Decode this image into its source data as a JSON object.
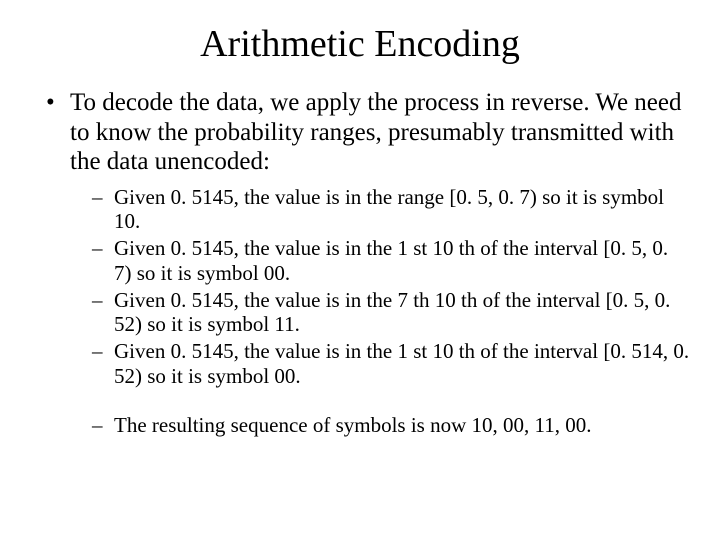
{
  "title": "Arithmetic Encoding",
  "main_bullet": "To decode the data, we apply the process in reverse.  We need to know the probability ranges, presumably transmitted with the data unencoded:",
  "sub": {
    "a": "Given 0. 5145, the value is in the range [0. 5, 0. 7) so it is symbol 10.",
    "b": "Given 0. 5145, the value is in the 1 st 10 th of the interval [0. 5, 0. 7) so it is symbol 00.",
    "c": "Given 0. 5145, the value is in the 7 th 10 th of the interval [0. 5, 0. 52) so it is symbol 11.",
    "d": "Given 0. 5145, the value is in the 1 st 10 th of the interval [0. 514, 0. 52) so it is symbol 00.",
    "e": "The resulting sequence of symbols is now 10, 00, 11, 00."
  }
}
